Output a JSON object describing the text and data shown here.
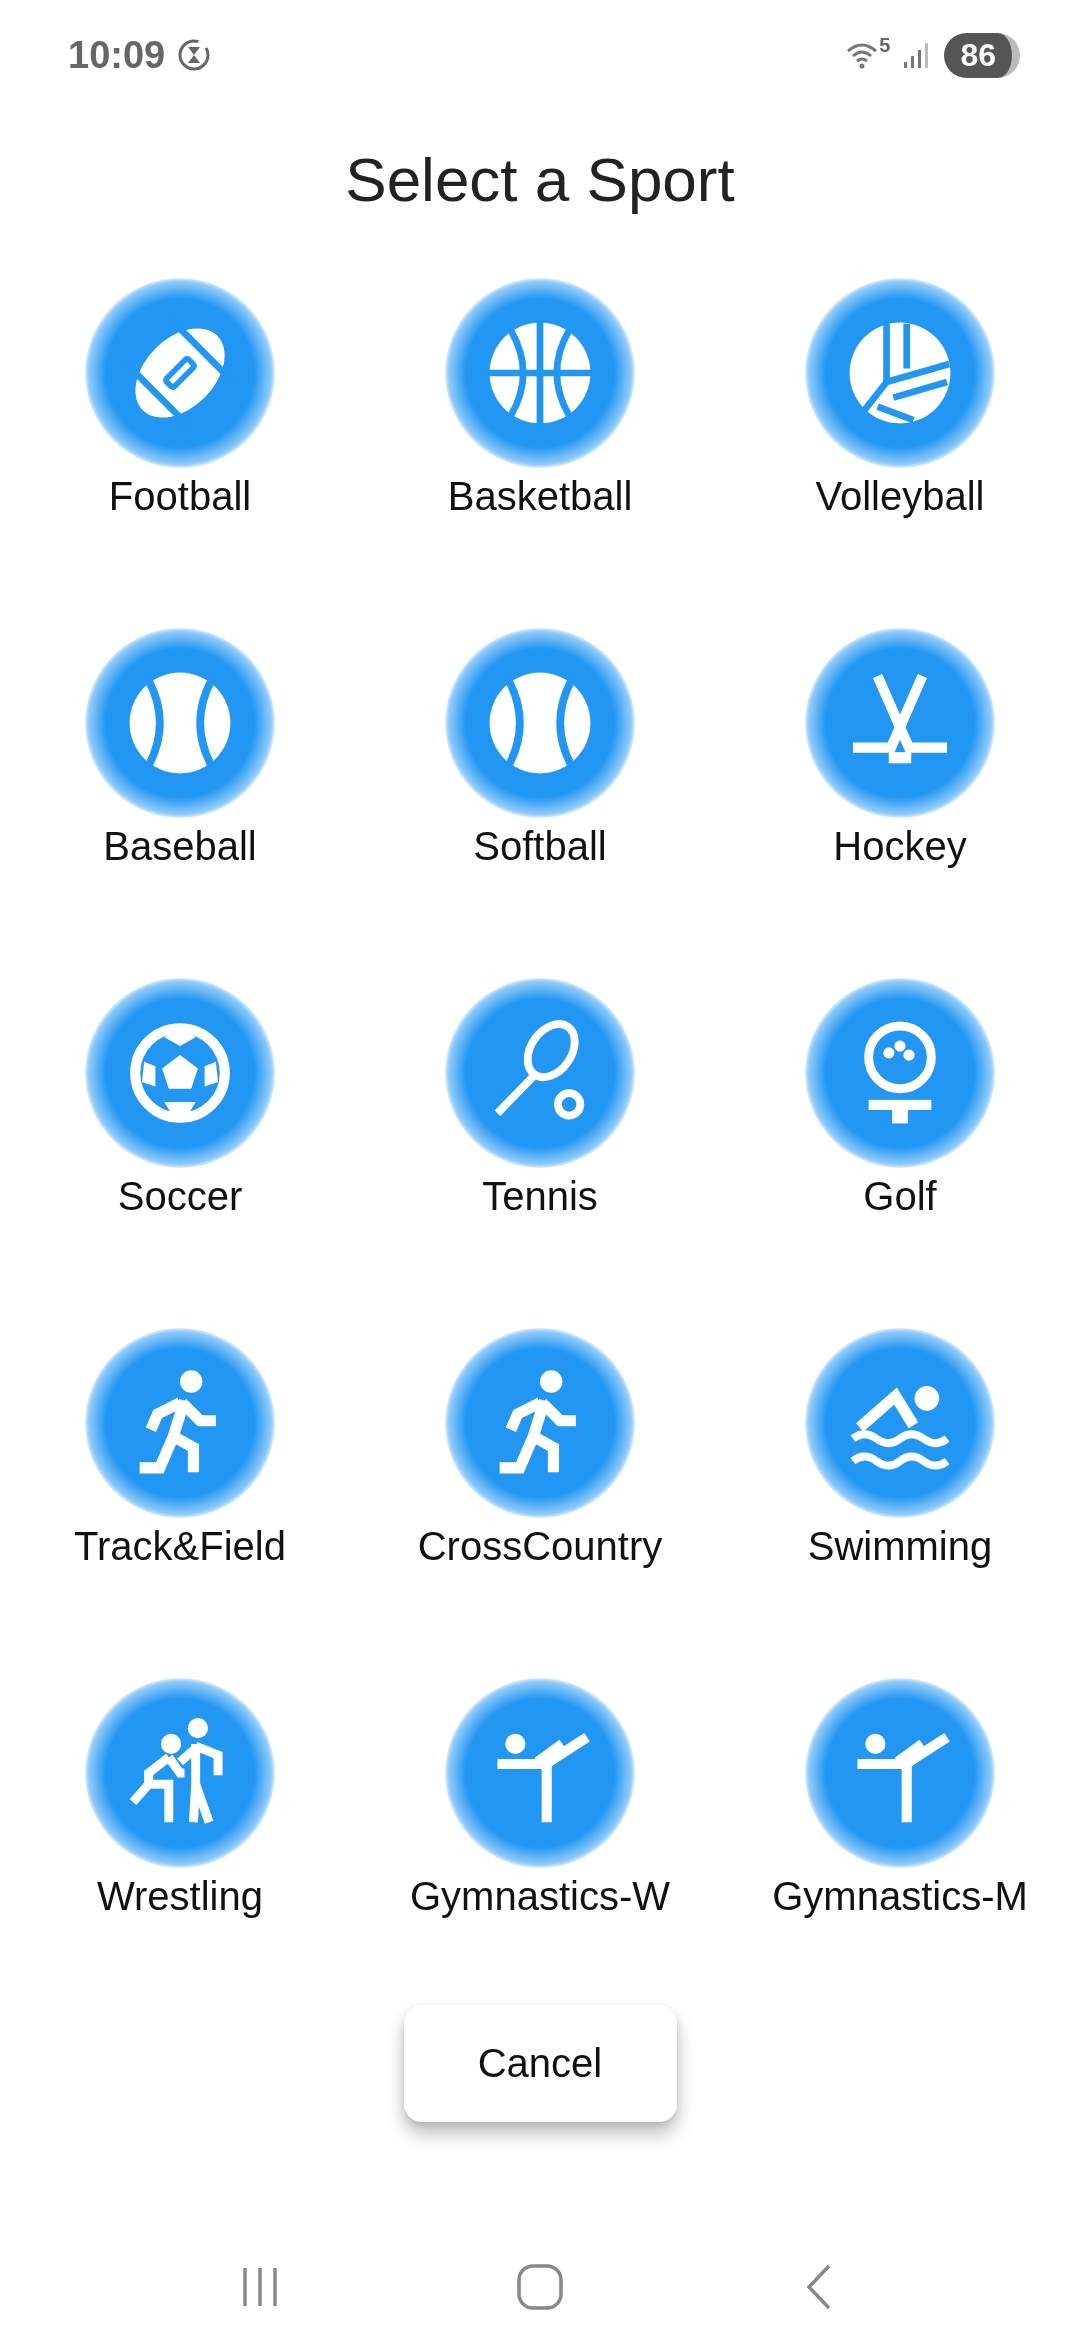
{
  "status_bar": {
    "time": "10:09",
    "wifi_label": "5",
    "battery": "86"
  },
  "title": "Select a Sport",
  "sports": [
    {
      "label": "Football",
      "kind": "football"
    },
    {
      "label": "Basketball",
      "kind": "basketball"
    },
    {
      "label": "Volleyball",
      "kind": "volleyball"
    },
    {
      "label": "Baseball",
      "kind": "baseball"
    },
    {
      "label": "Softball",
      "kind": "baseball"
    },
    {
      "label": "Hockey",
      "kind": "hockey"
    },
    {
      "label": "Soccer",
      "kind": "soccer"
    },
    {
      "label": "Tennis",
      "kind": "tennis"
    },
    {
      "label": "Golf",
      "kind": "golf"
    },
    {
      "label": "Track&Field",
      "kind": "runner"
    },
    {
      "label": "CrossCountry",
      "kind": "runner"
    },
    {
      "label": "Swimming",
      "kind": "swimmer"
    },
    {
      "label": "Wrestling",
      "kind": "wrestling"
    },
    {
      "label": "Gymnastics-W",
      "kind": "gymnast"
    },
    {
      "label": "Gymnastics-M",
      "kind": "gymnast"
    }
  ],
  "cancel_button": "Cancel"
}
